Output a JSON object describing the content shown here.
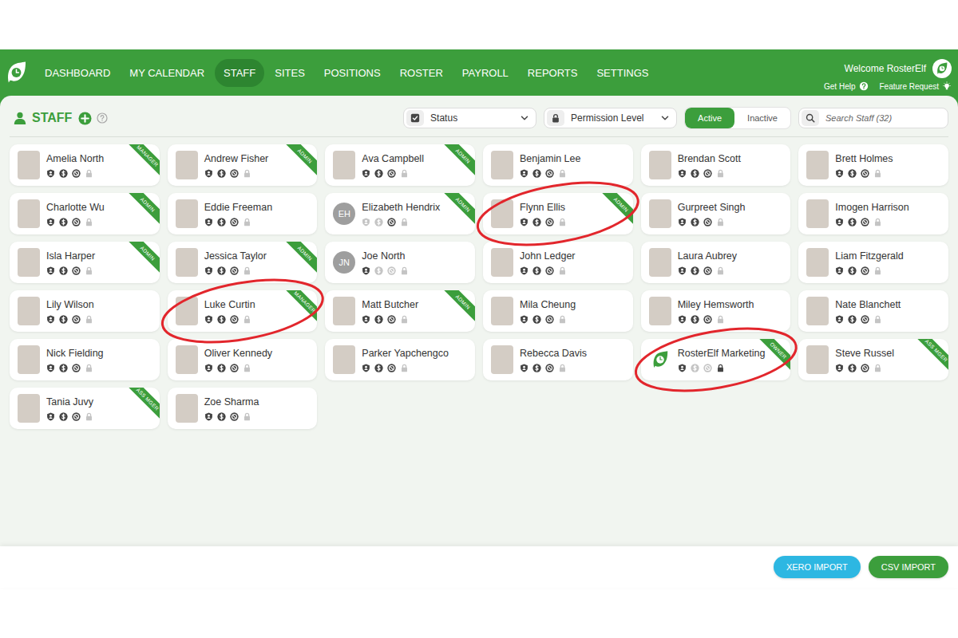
{
  "nav": {
    "items": [
      {
        "label": "DASHBOARD",
        "selected": false
      },
      {
        "label": "MY CALENDAR",
        "selected": false
      },
      {
        "label": "STAFF",
        "selected": true
      },
      {
        "label": "SITES",
        "selected": false
      },
      {
        "label": "POSITIONS",
        "selected": false
      },
      {
        "label": "ROSTER",
        "selected": false
      },
      {
        "label": "PAYROLL",
        "selected": false
      },
      {
        "label": "REPORTS",
        "selected": false
      },
      {
        "label": "SETTINGS",
        "selected": false
      }
    ],
    "welcome": "Welcome RosterElf",
    "help": "Get Help",
    "feature_request": "Feature Request"
  },
  "header": {
    "title": "STAFF",
    "filters": [
      {
        "label": "Status"
      },
      {
        "label": "Permission Level"
      }
    ],
    "toggle": [
      {
        "label": "Active",
        "selected": true
      },
      {
        "label": "Inactive",
        "selected": false
      }
    ],
    "search": {
      "placeholder": "Search Staff (32)"
    }
  },
  "staff": [
    {
      "name": "Amelia North",
      "role": "MANAGER",
      "kind": "photo",
      "icons_active": [
        true,
        true,
        true,
        false
      ],
      "highlighted": false
    },
    {
      "name": "Andrew Fisher",
      "role": "ADMIN",
      "kind": "photo",
      "icons_active": [
        true,
        true,
        true,
        false
      ],
      "highlighted": false
    },
    {
      "name": "Ava Campbell",
      "role": "ADMIN",
      "kind": "photo",
      "icons_active": [
        true,
        true,
        true,
        false
      ],
      "highlighted": false
    },
    {
      "name": "Benjamin Lee",
      "kind": "photo",
      "icons_active": [
        true,
        true,
        true,
        false
      ],
      "highlighted": false
    },
    {
      "name": "Brendan Scott",
      "kind": "photo",
      "icons_active": [
        true,
        true,
        true,
        false
      ],
      "highlighted": false
    },
    {
      "name": "Brett Holmes",
      "kind": "photo",
      "icons_active": [
        true,
        true,
        true,
        false
      ],
      "highlighted": false
    },
    {
      "name": "Charlotte Wu",
      "role": "ADMIN",
      "kind": "photo",
      "icons_active": [
        true,
        true,
        true,
        false
      ],
      "highlighted": false
    },
    {
      "name": "Eddie Freeman",
      "kind": "photo",
      "icons_active": [
        true,
        true,
        true,
        false
      ],
      "highlighted": false
    },
    {
      "name": "Elizabeth Hendrix",
      "role": "ADMIN",
      "kind": "initials",
      "initials": "EH",
      "icons_active": [
        false,
        false,
        true,
        false
      ],
      "highlighted": false
    },
    {
      "name": "Flynn Ellis",
      "role": "ADMIN",
      "kind": "photo",
      "icons_active": [
        true,
        true,
        true,
        false
      ],
      "highlighted": true
    },
    {
      "name": "Gurpreet Singh",
      "kind": "photo",
      "icons_active": [
        true,
        true,
        true,
        false
      ],
      "highlighted": false
    },
    {
      "name": "Imogen Harrison",
      "kind": "photo",
      "icons_active": [
        true,
        true,
        true,
        false
      ],
      "highlighted": false
    },
    {
      "name": "Isla Harper",
      "role": "ADMIN",
      "kind": "photo",
      "icons_active": [
        true,
        true,
        true,
        false
      ],
      "highlighted": false
    },
    {
      "name": "Jessica Taylor",
      "role": "ADMIN",
      "kind": "photo",
      "icons_active": [
        true,
        true,
        true,
        false
      ],
      "highlighted": false
    },
    {
      "name": "Joe North",
      "kind": "initials",
      "initials": "JN",
      "icons_active": [
        true,
        false,
        false,
        false
      ],
      "highlighted": false
    },
    {
      "name": "John Ledger",
      "kind": "photo",
      "icons_active": [
        true,
        true,
        true,
        false
      ],
      "highlighted": false
    },
    {
      "name": "Laura Aubrey",
      "kind": "photo",
      "icons_active": [
        true,
        true,
        true,
        false
      ],
      "highlighted": false
    },
    {
      "name": "Liam Fitzgerald",
      "kind": "photo",
      "icons_active": [
        true,
        true,
        true,
        false
      ],
      "highlighted": false
    },
    {
      "name": "Lily Wilson",
      "kind": "photo",
      "icons_active": [
        true,
        true,
        true,
        false
      ],
      "highlighted": false
    },
    {
      "name": "Luke Curtin",
      "role": "MANAGER",
      "kind": "photo",
      "icons_active": [
        true,
        true,
        true,
        false
      ],
      "highlighted": true
    },
    {
      "name": "Matt Butcher",
      "role": "ADMIN",
      "kind": "photo",
      "icons_active": [
        true,
        true,
        true,
        false
      ],
      "highlighted": false
    },
    {
      "name": "Mila Cheung",
      "kind": "photo",
      "icons_active": [
        true,
        true,
        true,
        false
      ],
      "highlighted": false
    },
    {
      "name": "Miley Hemsworth",
      "kind": "photo",
      "icons_active": [
        true,
        true,
        true,
        false
      ],
      "highlighted": false
    },
    {
      "name": "Nate Blanchett",
      "kind": "photo",
      "icons_active": [
        true,
        true,
        true,
        false
      ],
      "highlighted": false
    },
    {
      "name": "Nick Fielding",
      "kind": "photo",
      "icons_active": [
        true,
        true,
        true,
        false
      ],
      "highlighted": false
    },
    {
      "name": "Oliver Kennedy",
      "kind": "photo",
      "icons_active": [
        true,
        true,
        true,
        false
      ],
      "highlighted": false
    },
    {
      "name": "Parker Yapchengco",
      "kind": "photo",
      "icons_active": [
        true,
        true,
        true,
        false
      ],
      "highlighted": false
    },
    {
      "name": "Rebecca Davis",
      "kind": "photo",
      "icons_active": [
        true,
        true,
        true,
        false
      ],
      "highlighted": false
    },
    {
      "name": "RosterElf Marketing",
      "role": "OWNER",
      "kind": "logo",
      "icons_active": [
        true,
        false,
        false,
        true
      ],
      "highlighted": true
    },
    {
      "name": "Steve Russel",
      "role": "ASS MGER",
      "kind": "photo",
      "icons_active": [
        true,
        true,
        true,
        false
      ],
      "highlighted": false
    },
    {
      "name": "Tania Juvy",
      "role": "ASS MGER",
      "kind": "photo",
      "icons_active": [
        true,
        true,
        true,
        false
      ],
      "highlighted": false
    },
    {
      "name": "Zoe Sharma",
      "kind": "photo",
      "icons_active": [
        true,
        true,
        true,
        false
      ],
      "highlighted": false
    }
  ],
  "footer": {
    "buttons": [
      {
        "label": "XERO IMPORT",
        "color": "#2db7e2"
      },
      {
        "label": "CSV IMPORT",
        "color": "#3c9e3c"
      }
    ]
  }
}
